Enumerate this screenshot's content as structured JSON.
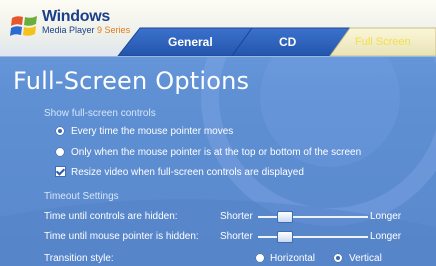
{
  "brand": {
    "title": "Windows",
    "subtitle": "Media Player",
    "version": "9 Series"
  },
  "tabs": [
    {
      "label": "General",
      "active": false
    },
    {
      "label": "CD",
      "active": false
    },
    {
      "label": "Full Screen",
      "active": true
    }
  ],
  "page_title": "Full-Screen Options",
  "show_controls": {
    "label": "Show full-screen controls",
    "options": [
      {
        "label": "Every time the mouse pointer moves",
        "selected": true
      },
      {
        "label": "Only when the mouse pointer is at the top or bottom of the screen",
        "selected": false
      }
    ],
    "resize_checkbox": {
      "label": "Resize video when full-screen controls are displayed",
      "checked": true
    }
  },
  "timeout": {
    "label": "Timeout Settings",
    "controls_hidden": {
      "label": "Time until controls are hidden:",
      "min": "Shorter",
      "max": "Longer",
      "level": 0.2
    },
    "pointer_hidden": {
      "label": "Time until mouse pointer is hidden:",
      "min": "Shorter",
      "max": "Longer",
      "level": 0.2
    }
  },
  "transition": {
    "label": "Transition style:",
    "options": [
      {
        "label": "Horizontal",
        "selected": false
      },
      {
        "label": "Vertical",
        "selected": true
      }
    ]
  },
  "colors": {
    "background": "#5f90d4",
    "tab_blue": "#2a5db7",
    "active_tab_text": "#f3e04a",
    "header": "#f5f6f0"
  }
}
